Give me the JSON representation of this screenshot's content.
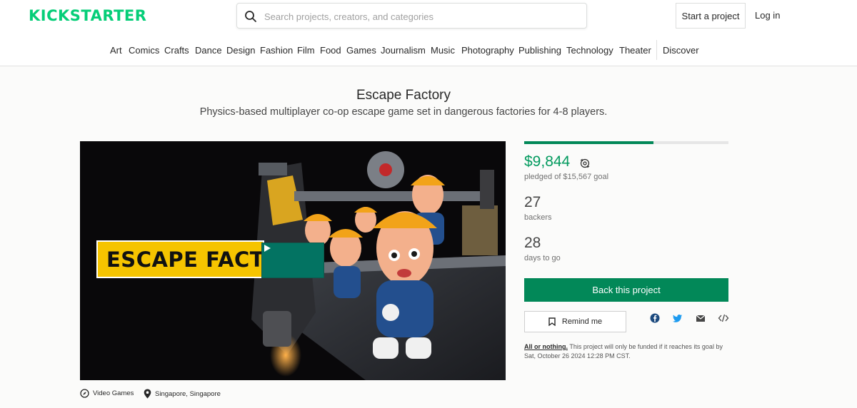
{
  "header": {
    "logo": "KICKSTARTER",
    "search_placeholder": "Search projects, creators, and categories",
    "start_project": "Start a project",
    "login": "Log in"
  },
  "nav": {
    "items": [
      "Art",
      "Comics",
      "Crafts",
      "Dance",
      "Design",
      "Fashion",
      "Film",
      "Food",
      "Games",
      "Journalism",
      "Music",
      "Photography",
      "Publishing",
      "Technology",
      "Theater"
    ],
    "discover": "Discover"
  },
  "project": {
    "title": "Escape Factory",
    "subtitle": "Physics-based multiplayer co-op escape game set in dangerous factories for 4-8 players.",
    "video_banner": "ESCAPE FACT"
  },
  "stats": {
    "funded_fraction": 0.632,
    "pledged": "$9,844",
    "pledged_sub": "pledged of $15,567 goal",
    "backers": "27",
    "backers_label": "backers",
    "days": "28",
    "days_label": "days to go"
  },
  "actions": {
    "back": "Back this project",
    "remind": "Remind me"
  },
  "fine_print": {
    "link": "All or nothing.",
    "text": " This project will only be funded if it reaches its goal by Sat, October 26 2024 12:28 PM CST."
  },
  "meta": {
    "category": "Video Games",
    "location": "Singapore, Singapore"
  },
  "colors": {
    "brand": "#05ce78",
    "accent": "#028858"
  }
}
